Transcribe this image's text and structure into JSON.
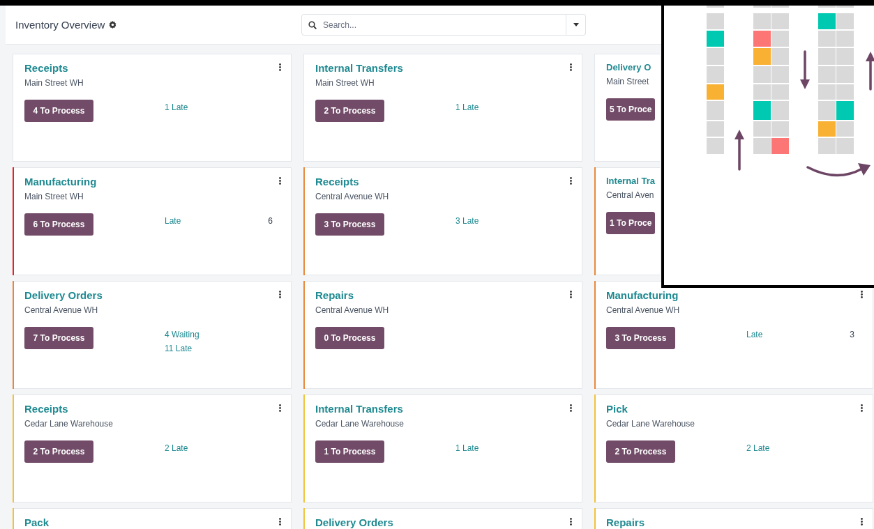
{
  "header": {
    "title": "Inventory Overview",
    "search": {
      "placeholder": "Search..."
    }
  },
  "cards": [
    {
      "title": "Receipts",
      "subtitle": "Main Street WH",
      "action": "4 To Process",
      "stats": [
        {
          "label": "1 Late"
        }
      ]
    },
    {
      "title": "Internal Transfers",
      "subtitle": "Main Street WH",
      "action": "2 To Process",
      "stats": [
        {
          "label": "1 Late"
        }
      ]
    },
    {
      "title": "Delivery O",
      "subtitle": "Main Street",
      "action": "5 To Proce"
    },
    {
      "title": "Manufacturing",
      "subtitle": "Main Street WH",
      "action": "6 To Process",
      "color": "#e8202a",
      "stats": [
        {
          "label": "Late",
          "value": "6"
        }
      ]
    },
    {
      "title": "Receipts",
      "subtitle": "Central Avenue WH",
      "action": "3 To Process",
      "color": "#e8883a",
      "stats": [
        {
          "label": "3 Late"
        }
      ]
    },
    {
      "title": "Internal Tra",
      "subtitle": "Central Aven",
      "action": "1 To Proce",
      "color": "#e8883a"
    },
    {
      "title": "Delivery Orders",
      "subtitle": "Central Avenue WH",
      "action": "7 To Process",
      "color": "#e8883a",
      "stats": [
        {
          "label": "4 Waiting"
        },
        {
          "label": "11 Late"
        }
      ]
    },
    {
      "title": "Repairs",
      "subtitle": "Central Avenue WH",
      "action": "0 To Process",
      "color": "#e8883a"
    },
    {
      "title": "Manufacturing",
      "subtitle": "Central Avenue WH",
      "action": "3 To Process",
      "color": "#e8883a",
      "stats": [
        {
          "label": "Late",
          "value": "3"
        }
      ]
    },
    {
      "title": "Receipts",
      "subtitle": "Cedar Lane Warehouse",
      "action": "2 To Process",
      "color": "#f0c33c",
      "stats": [
        {
          "label": "2 Late"
        }
      ]
    },
    {
      "title": "Internal Transfers",
      "subtitle": "Cedar Lane Warehouse",
      "action": "1 To Process",
      "color": "#f0c33c",
      "stats": [
        {
          "label": "1 Late"
        }
      ]
    },
    {
      "title": "Pick",
      "subtitle": "Cedar Lane Warehouse",
      "action": "2 To Process",
      "color": "#f0c33c",
      "stats": [
        {
          "label": "2 Late"
        }
      ]
    },
    {
      "title": "Pack",
      "color": "#f0c33c"
    },
    {
      "title": "Delivery Orders",
      "color": "#f0c33c"
    },
    {
      "title": "Repairs",
      "color": "#f0c33c"
    }
  ]
}
